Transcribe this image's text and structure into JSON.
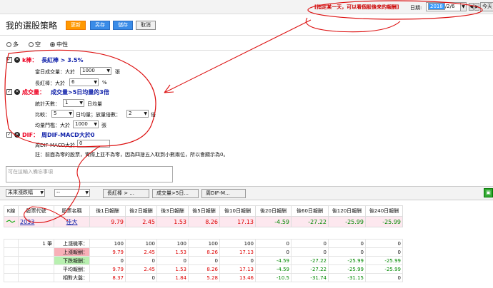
{
  "topbar": {
    "hint": "[指定某一天，可以看個股後來的報酬]",
    "date_label": "日期:",
    "date_year": "2018",
    "date_rest": "/2/6",
    "today_label": "今天"
  },
  "header": {
    "title": "我的選股策略",
    "buttons": [
      "更新",
      "另存",
      "儲存",
      "取消"
    ]
  },
  "bias": {
    "options": [
      "多",
      "空",
      "中性"
    ],
    "selected": 2
  },
  "criteria": {
    "k": {
      "tag": "k棒：",
      "desc": "長紅棒 > 3.5%",
      "row1": {
        "label": "當日成交量：大於",
        "value": "1000",
        "unit": "張"
      },
      "row2": {
        "label": "長紅棒：大於",
        "value": "6",
        "unit": "%"
      }
    },
    "vol": {
      "tag": "成交量：",
      "desc": "成交量>5日均量的3倍",
      "row1": {
        "label": "統計天數：",
        "value": "1",
        "unit": "日均量"
      },
      "row2": {
        "label": "比較：",
        "value": "5",
        "mid": "日均量；放量倍數：",
        "value2": "2",
        "unit": "倍"
      },
      "row3": {
        "label": "均量門檻：大於",
        "value": "1000",
        "unit": "張"
      }
    },
    "dif": {
      "tag": "DIF：",
      "desc": "周DIF-MACD大於0",
      "row1": {
        "label": "周DIF-MACD大於",
        "value": "0"
      },
      "note": "註：前面為零的股票，實際上並不為零，因為四捨五入取到小數兩位，所以會顯示為0。"
    }
  },
  "memo_placeholder": "可在這輸入備忘事項",
  "toolbar2": {
    "select1": "未來漲跌幅",
    "select2": "--",
    "tabs": [
      "長紅棒 > ...",
      "成交量>5日...",
      "周DIF-M..."
    ]
  },
  "table": {
    "headers": [
      "K線",
      "股票代號",
      "股票名稱",
      "後1日報酬",
      "後2日報酬",
      "後3日報酬",
      "後5日報酬",
      "後10日報酬",
      "後20日報酬",
      "後60日報酬",
      "後120日報酬",
      "後240日報酬"
    ],
    "rows": [
      {
        "code": "2033",
        "name": "佳大",
        "values": [
          "9.79",
          "2.45",
          "1.53",
          "8.26",
          "17.13",
          "-4.59",
          "-27.22",
          "-25.99",
          "-25.99"
        ]
      }
    ]
  },
  "stats": {
    "count": "1 筆",
    "rows": [
      {
        "label": "上漲機率：",
        "style": "",
        "values": [
          "100",
          "100",
          "100",
          "100",
          "100",
          "0",
          "0",
          "0",
          "0"
        ]
      },
      {
        "label": "上漲報酬：",
        "style": "red",
        "values": [
          "9.79",
          "2.45",
          "1.53",
          "8.26",
          "17.13",
          "0",
          "0",
          "0",
          "0"
        ]
      },
      {
        "label": "下跌報酬：",
        "style": "grn",
        "values": [
          "0",
          "0",
          "0",
          "0",
          "0",
          "-4.59",
          "-27.22",
          "-25.99",
          "-25.99"
        ]
      },
      {
        "label": "平均報酬：",
        "style": "",
        "values": [
          "9.79",
          "2.45",
          "1.53",
          "8.26",
          "17.13",
          "-4.59",
          "-27.22",
          "-25.99",
          "-25.99"
        ]
      },
      {
        "label": "相對大盤：",
        "style": "",
        "values": [
          "8.37",
          "0",
          "1.84",
          "5.28",
          "13.46",
          "-10.5",
          "-31.74",
          "-31.15",
          "0"
        ]
      }
    ]
  }
}
